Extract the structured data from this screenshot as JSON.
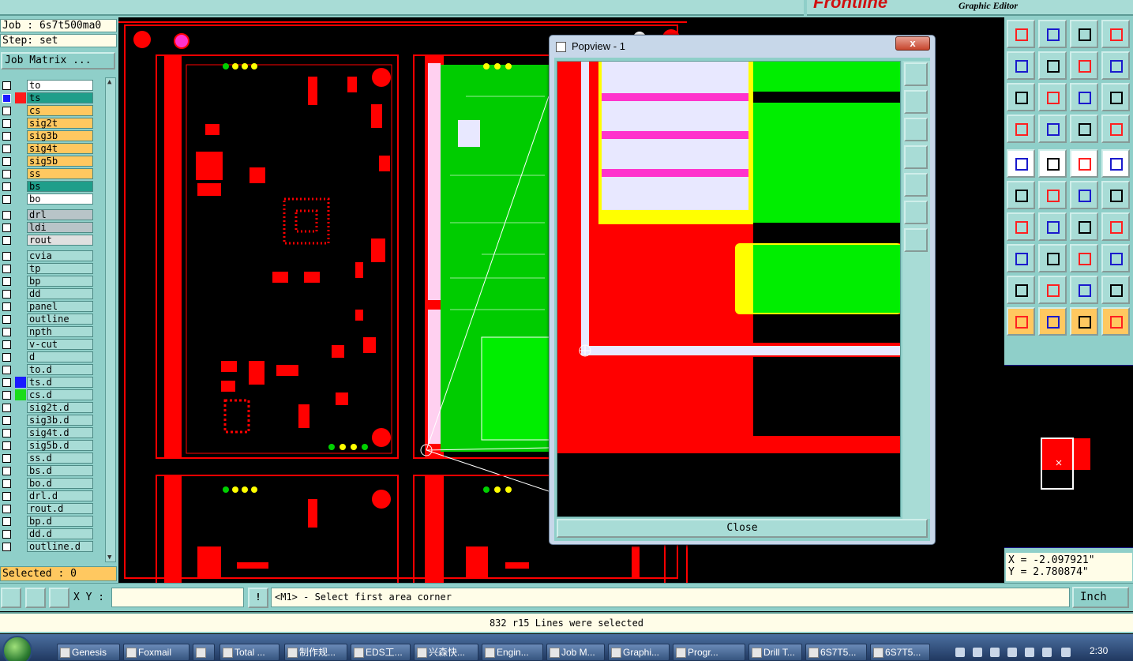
{
  "app": {
    "logo_text": "Frontline",
    "subtitle": "Graphic Editor"
  },
  "left_panel": {
    "job": "Job : 6s7t500ma0",
    "step": "Step: set",
    "job_matrix_label": "Job Matrix ...",
    "selected": "Selected : 0",
    "layers": [
      {
        "name": "to",
        "bg": "#ffffff",
        "swatch": "",
        "mark": ""
      },
      {
        "name": "ts",
        "bg": "#1f9e8a",
        "swatch": "#ff1a1a",
        "mark": "⊞",
        "checked_blue": true
      },
      {
        "name": "cs",
        "bg": "#ffc860",
        "swatch": "",
        "mark": ""
      },
      {
        "name": "sig2t",
        "bg": "#ffc860",
        "swatch": "",
        "mark": ""
      },
      {
        "name": "sig3b",
        "bg": "#ffc860",
        "swatch": "",
        "mark": ""
      },
      {
        "name": "sig4t",
        "bg": "#ffc860",
        "swatch": "",
        "mark": ""
      },
      {
        "name": "sig5b",
        "bg": "#ffc860",
        "swatch": "",
        "mark": ""
      },
      {
        "name": "ss",
        "bg": "#ffc860",
        "swatch": "",
        "mark": ""
      },
      {
        "name": "bs",
        "bg": "#1f9e8a",
        "swatch": "",
        "mark": ""
      },
      {
        "name": "bo",
        "bg": "#ffffff",
        "swatch": "",
        "mark": ""
      },
      {
        "name": "",
        "bg": "gap",
        "swatch": "",
        "mark": ""
      },
      {
        "name": "drl",
        "bg": "#b8c4c8",
        "swatch": "",
        "mark": ""
      },
      {
        "name": "ldi",
        "bg": "#b8c4c8",
        "swatch": "",
        "mark": ""
      },
      {
        "name": "rout",
        "bg": "#e0e0e0",
        "swatch": "",
        "mark": ""
      },
      {
        "name": "",
        "bg": "gap",
        "swatch": "",
        "mark": ""
      },
      {
        "name": "cvia",
        "bg": "#a8dcd6",
        "swatch": "",
        "mark": ""
      },
      {
        "name": "tp",
        "bg": "#a8dcd6",
        "swatch": "",
        "mark": ""
      },
      {
        "name": "bp",
        "bg": "#a8dcd6",
        "swatch": "",
        "mark": ""
      },
      {
        "name": "dd",
        "bg": "#a8dcd6",
        "swatch": "",
        "mark": ""
      },
      {
        "name": "panel",
        "bg": "#a8dcd6",
        "swatch": "",
        "mark": ""
      },
      {
        "name": "outline",
        "bg": "#a8dcd6",
        "swatch": "",
        "mark": ""
      },
      {
        "name": "npth",
        "bg": "#a8dcd6",
        "swatch": "",
        "mark": ""
      },
      {
        "name": "v-cut",
        "bg": "#a8dcd6",
        "swatch": "",
        "mark": ""
      },
      {
        "name": "d",
        "bg": "#a8dcd6",
        "swatch": "",
        "mark": ""
      },
      {
        "name": "to.d",
        "bg": "#a8dcd6",
        "swatch": "",
        "mark": "⌐"
      },
      {
        "name": "ts.d",
        "bg": "#a8dcd6",
        "swatch": "#1a1aff",
        "mark": "⌐"
      },
      {
        "name": "cs.d",
        "bg": "#a8dcd6",
        "swatch": "#1adc1a",
        "mark": "⌐"
      },
      {
        "name": "sig2t.d",
        "bg": "#a8dcd6",
        "swatch": "",
        "mark": "⌐"
      },
      {
        "name": "sig3b.d",
        "bg": "#a8dcd6",
        "swatch": "",
        "mark": "⌐"
      },
      {
        "name": "sig4t.d",
        "bg": "#a8dcd6",
        "swatch": "",
        "mark": "⌐"
      },
      {
        "name": "sig5b.d",
        "bg": "#a8dcd6",
        "swatch": "",
        "mark": "⌐"
      },
      {
        "name": "ss.d",
        "bg": "#a8dcd6",
        "swatch": "",
        "mark": "⌐"
      },
      {
        "name": "bs.d",
        "bg": "#a8dcd6",
        "swatch": "",
        "mark": "⌐"
      },
      {
        "name": "bo.d",
        "bg": "#a8dcd6",
        "swatch": "",
        "mark": "⌐"
      },
      {
        "name": "drl.d",
        "bg": "#a8dcd6",
        "swatch": "",
        "mark": ""
      },
      {
        "name": "rout.d",
        "bg": "#a8dcd6",
        "swatch": "",
        "mark": ""
      },
      {
        "name": "bp.d",
        "bg": "#a8dcd6",
        "swatch": "",
        "mark": "⌐"
      },
      {
        "name": "dd.d",
        "bg": "#a8dcd6",
        "swatch": "",
        "mark": "⌐"
      },
      {
        "name": "outline.d",
        "bg": "#a8dcd6",
        "swatch": "",
        "mark": "⌐"
      }
    ]
  },
  "popview": {
    "title": "Popview - 1",
    "close_label": "Close",
    "close_x": "x"
  },
  "right_panel": {
    "coord_x": "X = -2.097921\"",
    "coord_y": "Y = 2.780874\""
  },
  "command": {
    "xy_label": "X Y :",
    "xy_value": "",
    "info_icon": "!",
    "prompt": "<M1> - Select first area corner",
    "unit": "Inch"
  },
  "status": "832 r15 Lines were selected",
  "taskbar": {
    "items": [
      "Genesis",
      "Foxmail",
      "",
      "Total ...",
      "制作规...",
      "EDS工...",
      "兴森快...",
      "Engin...",
      "Job M...",
      "Graphi...",
      "Progr...",
      "Drill T...",
      "6S7T5...",
      "6S7T5..."
    ],
    "clock": "2:30"
  },
  "colors": {
    "panel": "#8fcfc9",
    "copper_red": "#ff0000",
    "green": "#00e000",
    "yellow": "#ffff00",
    "magenta": "#ff33cc",
    "highlight": "#ffc860"
  }
}
